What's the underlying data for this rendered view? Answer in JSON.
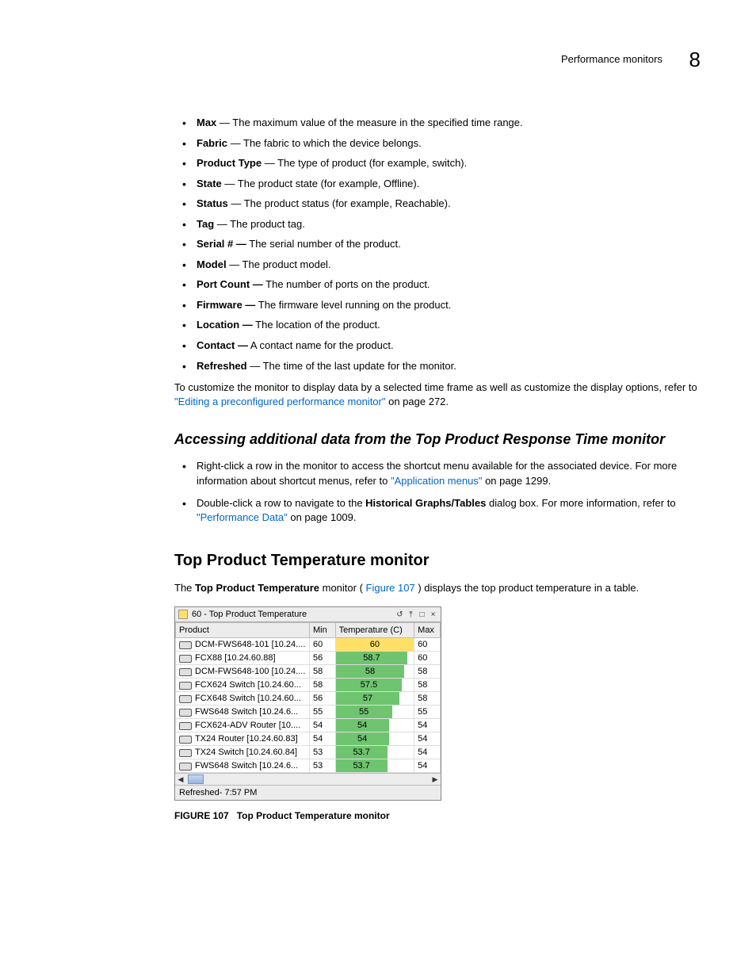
{
  "header": {
    "title": "Performance monitors",
    "chapter": "8"
  },
  "defs": [
    {
      "term": "Max",
      "desc": " — The maximum value of the measure in the specified time range."
    },
    {
      "term": "Fabric",
      "desc": " — The fabric to which the device belongs."
    },
    {
      "term": "Product Type",
      "desc": " — The type of product (for example, switch)."
    },
    {
      "term": "State",
      "desc": " — The product state (for example, Offline)."
    },
    {
      "term": "Status",
      "desc": " — The product status (for example, Reachable)."
    },
    {
      "term": "Tag",
      "desc": " — The product tag."
    },
    {
      "term": "Serial # —",
      "desc": " The serial number of the product."
    },
    {
      "term": "Model",
      "desc": " — The product model."
    },
    {
      "term": "Port Count —",
      "desc": " The number of ports on the product."
    },
    {
      "term": "Firmware —",
      "desc": " The firmware level running on the product."
    },
    {
      "term": "Location —",
      "desc": " The location of the product."
    },
    {
      "term": "Contact —",
      "desc": " A contact name for the product."
    },
    {
      "term": "Refreshed",
      "desc": " — The time of the last update for the monitor."
    }
  ],
  "customize": {
    "prefix": "To customize the monitor to display data by a selected time frame as well as customize the display options, refer to ",
    "link": "\"Editing a preconfigured performance monitor\"",
    "suffix": " on page 272."
  },
  "heading_access": "Accessing additional data from the Top Product Response Time monitor",
  "access": [
    {
      "pre": "Right-click a row in the monitor to access the shortcut menu available for the associated device. For more information about shortcut menus, refer to ",
      "link": "\"Application menus\"",
      "post": " on page 1299."
    },
    {
      "pre": "Double-click a row to navigate to the ",
      "bold": "Historical Graphs/Tables",
      "mid": " dialog box. For more information, refer to ",
      "link": "\"Performance Data\"",
      "post": " on page 1009."
    }
  ],
  "heading_section": "Top Product Temperature monitor",
  "intro": {
    "pre": "The ",
    "bold": "Top Product Temperature",
    "mid": " monitor (",
    "link": "Figure 107",
    "post": ") displays the top product temperature in a table."
  },
  "monitor": {
    "title": "60 - Top Product Temperature",
    "cols": [
      "Product",
      "Min",
      "Temperature (C)",
      "Max"
    ],
    "rows": [
      {
        "product": "DCM-FWS648-101 [10.24....",
        "min": "60",
        "temp": "60",
        "max": "60",
        "pct": 100,
        "color": "#ffe066"
      },
      {
        "product": "FCX88 [10.24.60.88]",
        "min": "56",
        "temp": "58.7",
        "max": "60",
        "pct": 92,
        "color": "#6fc46f"
      },
      {
        "product": "DCM-FWS648-100 [10.24....",
        "min": "58",
        "temp": "58",
        "max": "58",
        "pct": 88,
        "color": "#6fc46f"
      },
      {
        "product": "FCX624 Switch [10.24.60...",
        "min": "58",
        "temp": "57.5",
        "max": "58",
        "pct": 85,
        "color": "#6fc46f"
      },
      {
        "product": "FCX648 Switch [10.24.60...",
        "min": "56",
        "temp": "57",
        "max": "58",
        "pct": 82,
        "color": "#6fc46f"
      },
      {
        "product": "FWS648 Switch [10.24.6...",
        "min": "55",
        "temp": "55",
        "max": "55",
        "pct": 72,
        "color": "#6fc46f"
      },
      {
        "product": "FCX624-ADV Router [10....",
        "min": "54",
        "temp": "54",
        "max": "54",
        "pct": 68,
        "color": "#6fc46f"
      },
      {
        "product": "TX24 Router [10.24.60.83]",
        "min": "54",
        "temp": "54",
        "max": "54",
        "pct": 68,
        "color": "#6fc46f"
      },
      {
        "product": "TX24 Switch [10.24.60.84]",
        "min": "53",
        "temp": "53.7",
        "max": "54",
        "pct": 66,
        "color": "#6fc46f"
      },
      {
        "product": "FWS648 Switch [10.24.6...",
        "min": "53",
        "temp": "53.7",
        "max": "54",
        "pct": 66,
        "color": "#6fc46f"
      }
    ],
    "footer": "Refreshed- 7:57 PM"
  },
  "figcap": {
    "label": "FIGURE 107",
    "text": "Top Product Temperature monitor"
  },
  "chart_data": {
    "type": "bar",
    "title": "60 - Top Product Temperature",
    "xlabel": "Temperature (C)",
    "ylabel": "Product",
    "categories": [
      "DCM-FWS648-101 [10.24....]",
      "FCX88 [10.24.60.88]",
      "DCM-FWS648-100 [10.24....]",
      "FCX624 Switch [10.24.60...]",
      "FCX648 Switch [10.24.60...]",
      "FWS648 Switch [10.24.6...]",
      "FCX624-ADV Router [10....]",
      "TX24 Router [10.24.60.83]",
      "TX24 Switch [10.24.60.84]",
      "FWS648 Switch [10.24.6...]"
    ],
    "series": [
      {
        "name": "Min",
        "values": [
          60,
          56,
          58,
          58,
          56,
          55,
          54,
          54,
          53,
          53
        ]
      },
      {
        "name": "Temperature (C)",
        "values": [
          60,
          58.7,
          58,
          57.5,
          57,
          55,
          54,
          54,
          53.7,
          53.7
        ]
      },
      {
        "name": "Max",
        "values": [
          60,
          60,
          58,
          58,
          58,
          55,
          54,
          54,
          54,
          54
        ]
      }
    ]
  }
}
